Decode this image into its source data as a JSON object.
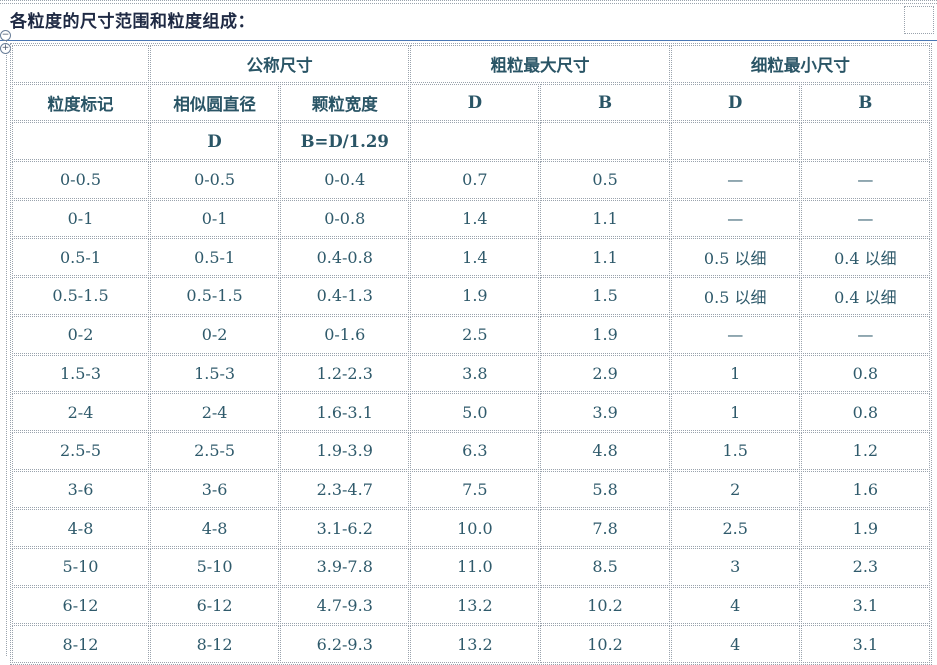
{
  "title": "各粒度的尺寸范围和粒度组成：",
  "handles": {
    "collapse": "−",
    "move": "+"
  },
  "table": {
    "group_headers": {
      "nominal": "公称尺寸",
      "coarse_max": "粗粒最大尺寸",
      "fine_min": "细粒最小尺寸"
    },
    "column_headers": [
      "粒度标记",
      "相似圆直径",
      "颗粒宽度",
      "D",
      "B",
      "D",
      "B"
    ],
    "sub_headers": [
      "",
      "D",
      "B=D/1.29",
      "",
      "",
      "",
      ""
    ],
    "rows": [
      [
        "0-0.5",
        "0-0.5",
        "0-0.4",
        "0.7",
        "0.5",
        "—",
        "—"
      ],
      [
        "0-1",
        "0-1",
        "0-0.8",
        "1.4",
        "1.1",
        "—",
        "—"
      ],
      [
        "0.5-1",
        "0.5-1",
        "0.4-0.8",
        "1.4",
        "1.1",
        "0.5 以细",
        "0.4 以细"
      ],
      [
        "0.5-1.5",
        "0.5-1.5",
        "0.4-1.3",
        "1.9",
        "1.5",
        "0.5 以细",
        "0.4 以细"
      ],
      [
        "0-2",
        "0-2",
        "0-1.6",
        "2.5",
        "1.9",
        "—",
        "—"
      ],
      [
        "1.5-3",
        "1.5-3",
        "1.2-2.3",
        "3.8",
        "2.9",
        "1",
        "0.8"
      ],
      [
        "2-4",
        "2-4",
        "1.6-3.1",
        "5.0",
        "3.9",
        "1",
        "0.8"
      ],
      [
        "2.5-5",
        "2.5-5",
        "1.9-3.9",
        "6.3",
        "4.8",
        "1.5",
        "1.2"
      ],
      [
        "3-6",
        "3-6",
        "2.3-4.7",
        "7.5",
        "5.8",
        "2",
        "1.6"
      ],
      [
        "4-8",
        "4-8",
        "3.1-6.2",
        "10.0",
        "7.8",
        "2.5",
        "1.9"
      ],
      [
        "5-10",
        "5-10",
        "3.9-7.8",
        "11.0",
        "8.5",
        "3",
        "2.3"
      ],
      [
        "6-12",
        "6-12",
        "4.7-9.3",
        "13.2",
        "10.2",
        "4",
        "3.1"
      ],
      [
        "8-12",
        "8-12",
        "6.2-9.3",
        "13.2",
        "10.2",
        "4",
        "3.1"
      ]
    ]
  }
}
